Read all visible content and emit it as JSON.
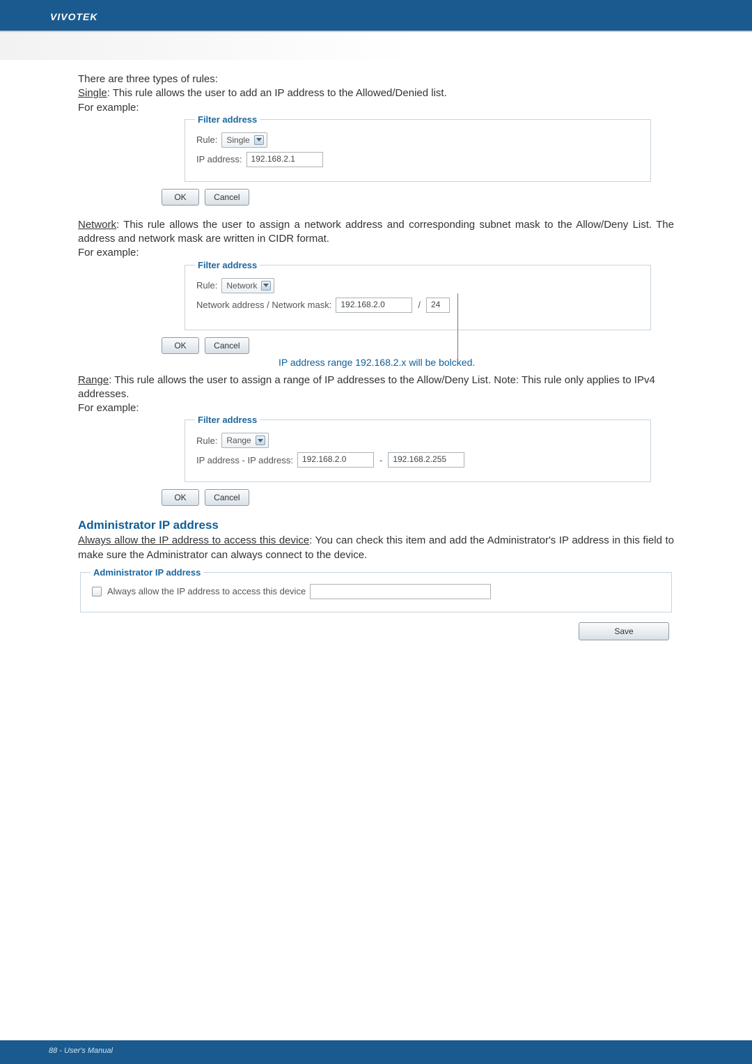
{
  "header": {
    "brand": "VIVOTEK"
  },
  "intro": {
    "line1": "There are three types of rules:",
    "single_label": "Single",
    "single_text": ": This rule allows the user to add an IP address to the Allowed/Denied list.",
    "for_example": "For example:"
  },
  "single_panel": {
    "legend": "Filter address",
    "rule_label": "Rule:",
    "rule_value": "Single",
    "ip_label": "IP address:",
    "ip_value": "192.168.2.1",
    "ok": "OK",
    "cancel": "Cancel"
  },
  "network_desc": {
    "label": "Network",
    "text": ": This rule allows the user to assign a network address and corresponding subnet mask to the Allow/Deny List. The address and network mask are written in CIDR format.",
    "for_example": "For example:"
  },
  "network_panel": {
    "legend": "Filter address",
    "rule_label": "Rule:",
    "rule_value": "Network",
    "net_label": "Network address / Network mask:",
    "net_value": "192.168.2.0",
    "slash": "/",
    "mask_value": "24",
    "ok": "OK",
    "cancel": "Cancel",
    "annotation": "IP address range 192.168.2.x will be bolcked."
  },
  "range_desc": {
    "label": "Range",
    "text": ": This rule allows the user to assign a range of IP addresses to the Allow/Deny List. Note: This rule only applies to IPv4 addresses.",
    "for_example": "For example:"
  },
  "range_panel": {
    "legend": "Filter address",
    "rule_label": "Rule:",
    "rule_value": "Range",
    "ip_label": "IP address - IP address:",
    "ip_from": "192.168.2.0",
    "dash": "-",
    "ip_to": "192.168.2.255",
    "ok": "OK",
    "cancel": "Cancel"
  },
  "admin": {
    "title": "Administrator IP address",
    "always_label": "Always allow the IP address to access this device",
    "desc": ": You can check this item and add the Administrator's IP address in this field to make sure the Administrator can always connect to the device.",
    "legend": "Administrator IP address",
    "checkbox_label": "Always allow the IP address to access this device",
    "save": "Save"
  },
  "footer": {
    "page": "88 - User's Manual"
  }
}
